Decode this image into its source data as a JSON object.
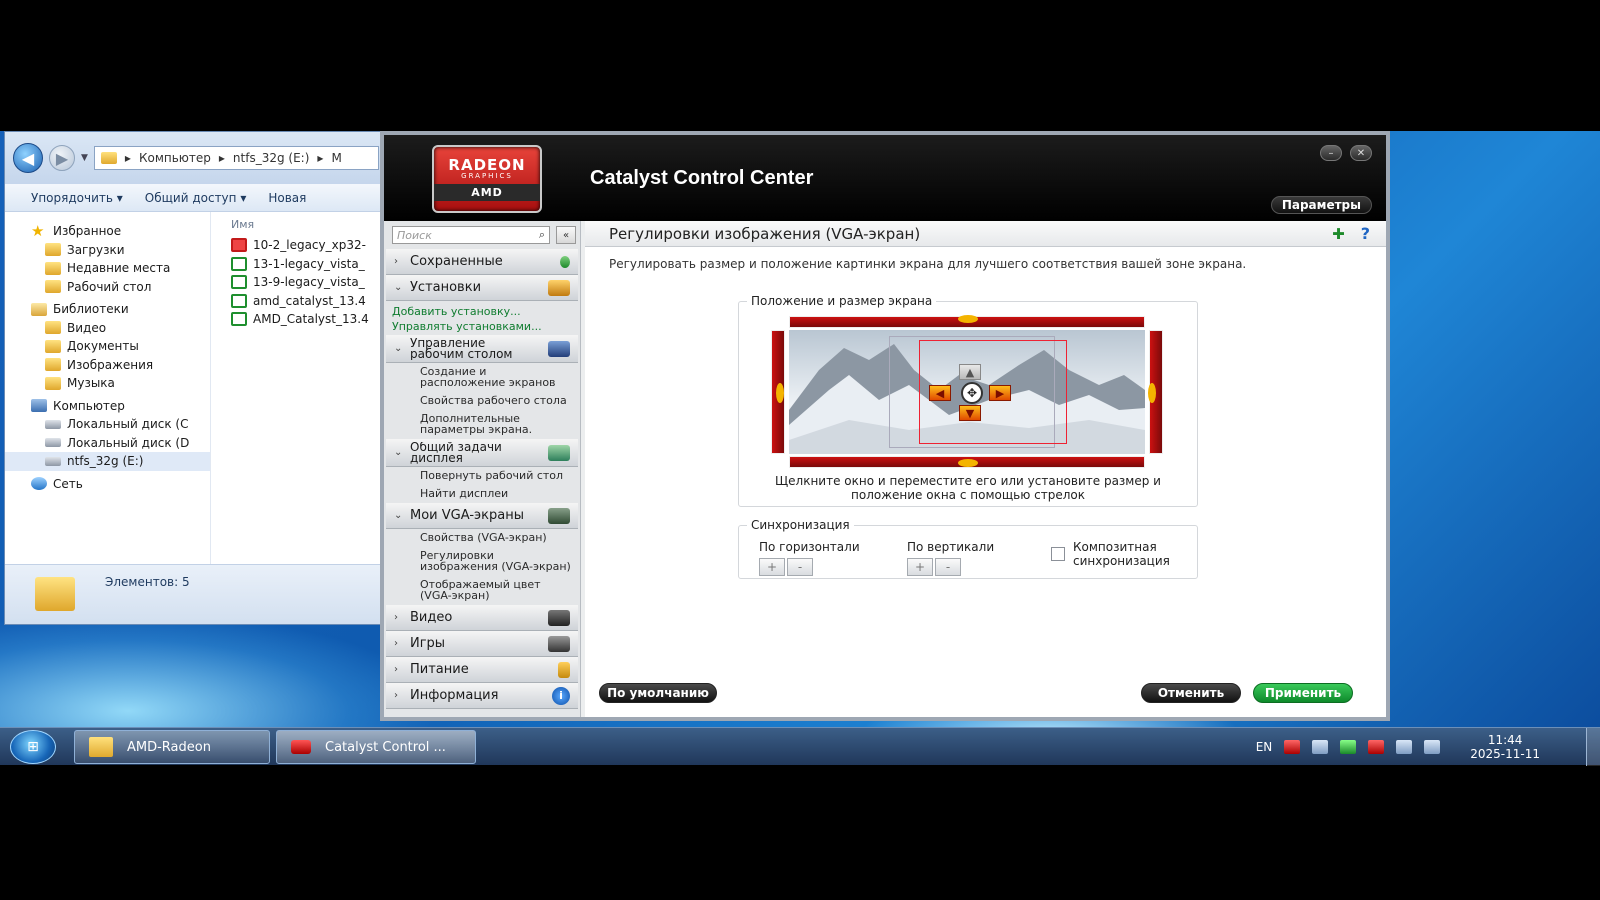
{
  "explorer": {
    "address_parts": [
      "Компьютер",
      "ntfs_32g (E:)",
      "M"
    ],
    "toolbar": [
      "Упорядочить ▾",
      "Общий доступ ▾",
      "Новая"
    ],
    "tree": [
      {
        "label": "Избранное",
        "level": 0,
        "icon": "star-icon"
      },
      {
        "label": "Загрузки",
        "level": 1,
        "icon": "downloads-icon"
      },
      {
        "label": "Недавние места",
        "level": 1,
        "icon": "recent-places-icon"
      },
      {
        "label": "Рабочий стол",
        "level": 1,
        "icon": "desktop-icon"
      },
      {
        "label": "Библиотеки",
        "level": 0,
        "icon": "libraries-icon"
      },
      {
        "label": "Видео",
        "level": 1,
        "icon": "video-icon"
      },
      {
        "label": "Документы",
        "level": 1,
        "icon": "documents-icon"
      },
      {
        "label": "Изображения",
        "level": 1,
        "icon": "pictures-icon"
      },
      {
        "label": "Музыка",
        "level": 1,
        "icon": "music-icon"
      },
      {
        "label": "Компьютер",
        "level": 0,
        "icon": "computer-icon"
      },
      {
        "label": "Локальный диск (C",
        "level": 1,
        "icon": "disk-icon"
      },
      {
        "label": "Локальный диск (D",
        "level": 1,
        "icon": "disk-icon"
      },
      {
        "label": "ntfs_32g (E:)",
        "level": 1,
        "icon": "disk-icon",
        "selected": true
      },
      {
        "label": "Сеть",
        "level": 0,
        "icon": "network-icon"
      }
    ],
    "column_name": "Имя",
    "files": [
      {
        "name": "10-2_legacy_xp32-",
        "icon": "pdf-icon"
      },
      {
        "name": "13-1-legacy_vista_",
        "icon": "amd-installer-icon"
      },
      {
        "name": "13-9-legacy_vista_",
        "icon": "amd-installer-icon"
      },
      {
        "name": "amd_catalyst_13.4",
        "icon": "amd-installer-icon"
      },
      {
        "name": "AMD_Catalyst_13.4",
        "icon": "amd-installer-icon"
      }
    ],
    "status": "Элементов: 5"
  },
  "ccc": {
    "logo": {
      "top": "RADEON",
      "mid": "GRAPHICS",
      "bottom": "AMD"
    },
    "title": "Catalyst Control Center",
    "params_button": "Параметры",
    "search_placeholder": "Поиск",
    "sidebar": {
      "saved": "Сохраненные",
      "presets": "Установки",
      "add_preset": "Добавить установку...",
      "manage_presets": "Управлять установками...",
      "desktop_mgmt": "Управление рабочим столом",
      "desktop_sub": [
        "Создание и расположение экранов",
        "Свойства рабочего стола",
        "Дополнительные параметры экрана."
      ],
      "display_tasks": "Общий задачи дисплея",
      "display_sub": [
        "Повернуть рабочий стол",
        "Найти дисплеи"
      ],
      "vga": "Мои VGA-экраны",
      "vga_sub": [
        "Свойства (VGA-экран)",
        "Регулировки изображения (VGA-экран)",
        "Отображаемый цвет (VGA-экран)"
      ],
      "video": "Видео",
      "games": "Игры",
      "power": "Питание",
      "info": "Информация"
    },
    "page_title": "Регулировки изображения (VGA-экран)",
    "help_glyph": "?",
    "description": "Регулировать размер и положение картинки экрана для лучшего соответствия вашей зоне экрана.",
    "position_group": "Положение и размер экрана",
    "position_caption": "Щелкните окно и переместите его или установите размер и положение окна с помощью стрелок",
    "sync_group": "Синхронизация",
    "horizontal": "По горизонтали",
    "vertical": "По вертикали",
    "composite": "Композитная синхронизация",
    "plus": "+",
    "minus": "-",
    "btn_default": "По умолчанию",
    "btn_cancel": "Отменить",
    "btn_apply": "Применить"
  },
  "taskbar": {
    "tasks": [
      "AMD-Radeon",
      "Catalyst Control ..."
    ],
    "lang": "EN",
    "time": "11:44",
    "date": "2025-11-11"
  },
  "colors": {
    "amd_red": "#c11",
    "apply_green": "#18a83c",
    "link_green": "#0f7c2f"
  }
}
